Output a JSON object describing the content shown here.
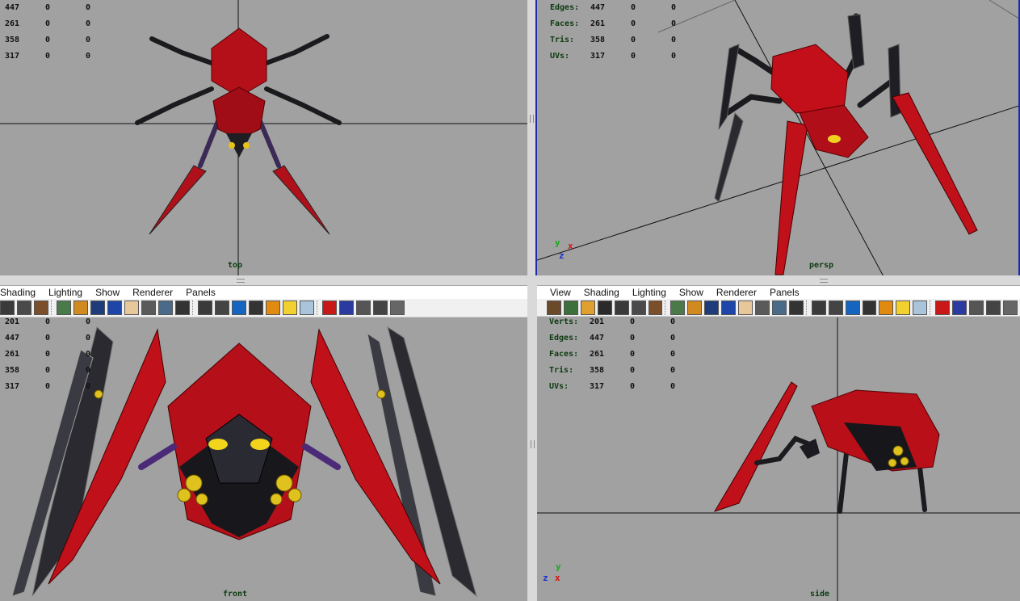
{
  "viewports": {
    "top": {
      "name": "top",
      "stats": [
        {
          "label": "",
          "v": "447",
          "a": "0",
          "b": "0"
        },
        {
          "label": "",
          "v": "261",
          "a": "0",
          "b": "0"
        },
        {
          "label": "",
          "v": "358",
          "a": "0",
          "b": "0"
        },
        {
          "label": "",
          "v": "317",
          "a": "0",
          "b": "0"
        }
      ]
    },
    "persp": {
      "name": "persp",
      "stats": [
        {
          "label": "Edges:",
          "v": "447",
          "a": "0",
          "b": "0"
        },
        {
          "label": "Faces:",
          "v": "261",
          "a": "0",
          "b": "0"
        },
        {
          "label": "Tris:",
          "v": "358",
          "a": "0",
          "b": "0"
        },
        {
          "label": "UVs:",
          "v": "317",
          "a": "0",
          "b": "0"
        }
      ],
      "axis": {
        "y": "y",
        "x": "x",
        "z": "z"
      }
    },
    "front": {
      "name": "front",
      "menu": [
        "Shading",
        "Lighting",
        "Show",
        "Renderer",
        "Panels"
      ],
      "stats": [
        {
          "label": "",
          "v": "201",
          "a": "0",
          "b": "0"
        },
        {
          "label": "",
          "v": "447",
          "a": "0",
          "b": "0"
        },
        {
          "label": "",
          "v": "261",
          "a": "0",
          "b": "0"
        },
        {
          "label": "",
          "v": "358",
          "a": "0",
          "b": "0"
        },
        {
          "label": "",
          "v": "317",
          "a": "0",
          "b": "0"
        }
      ]
    },
    "side": {
      "name": "side",
      "menu": [
        "View",
        "Shading",
        "Lighting",
        "Show",
        "Renderer",
        "Panels"
      ],
      "stats": [
        {
          "label": "Verts:",
          "v": "201",
          "a": "0",
          "b": "0"
        },
        {
          "label": "Edges:",
          "v": "447",
          "a": "0",
          "b": "0"
        },
        {
          "label": "Faces:",
          "v": "261",
          "a": "0",
          "b": "0"
        },
        {
          "label": "Tris:",
          "v": "358",
          "a": "0",
          "b": "0"
        },
        {
          "label": "UVs:",
          "v": "317",
          "a": "0",
          "b": "0"
        }
      ],
      "axis": {
        "y": "y",
        "x": "x",
        "z": "z"
      }
    }
  },
  "toolbar_icons": [
    "wireframe-icon",
    "smooth-shade-icon",
    "texture-icon",
    "grid-icon",
    "camera-icon",
    "select-camera-icon",
    "bookmark-icon",
    "image-plane-icon",
    "shaded-icon",
    "wire-on-shaded-icon",
    "xray-icon",
    "backface-icon",
    "isolate-icon",
    "resolution-gate-icon",
    "safe-title-icon",
    "textured-icon",
    "cube-icon",
    "blue-cube-icon",
    "dark-cube-icon",
    "light-icon",
    "bulb-icon",
    "pale-cube-icon",
    "red-cube-icon",
    "frame-icon",
    "box-icon",
    "grid-frame-icon",
    "hypershade-icon"
  ],
  "colors": {
    "viewport_bg": "#a1a1a1",
    "active_border": "#1e2aa8",
    "spider_red": "#c0101a",
    "spider_dark": "#1a1a1f"
  }
}
